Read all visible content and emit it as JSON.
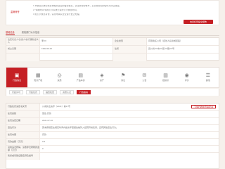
{
  "notice": {
    "label": "监管帐号",
    "lines": [
      "1.本信息系统仅供查询相关企业的备案信息，请注意保管帐号，妥善保管您的密码以防止泄露。",
      "2.\"填报时间\"指在公示系统上提交公示信息时间。",
      "3.如公示信息有误，请及时联系企业进行更正处理。"
    ],
    "report_button": "向商标局提交报告"
  },
  "tabs": [
    {
      "label": "基础信息",
      "active": true
    },
    {
      "label": "其他部门公示信息",
      "active": false
    }
  ],
  "info_rows": [
    [
      [
        "法定代表人/负责人/执行事务合伙人",
        "李XX"
      ],
      [
        "企业类型",
        "有限责任公司（自然人投资或控股）"
      ]
    ],
    [
      [
        "成立日期",
        "1992.09.20"
      ],
      [
        "住所",
        "四川省XX市XX区XX路XX号"
      ]
    ]
  ],
  "categories": [
    {
      "icon": "▣",
      "label": "行政信息",
      "active": true
    },
    {
      "icon": "▦",
      "label": "知识产权",
      "active": false
    },
    {
      "icon": "◎",
      "label": "资质",
      "active": false
    },
    {
      "icon": "▤",
      "label": "产品本身",
      "active": false
    },
    {
      "icon": "◈",
      "label": "资产",
      "active": false
    },
    {
      "icon": "⚑",
      "label": "诉讼",
      "active": false
    },
    {
      "icon": "✉",
      "label": "公告",
      "active": false
    },
    {
      "icon": "▥",
      "label": "招投标",
      "active": false
    },
    {
      "icon": "◉",
      "label": "评价",
      "active": false
    },
    {
      "icon": "☰",
      "label": "其他",
      "active": false
    }
  ],
  "subtabs": [
    {
      "label": "行政许可",
      "active": false
    },
    {
      "label": "行政处罚",
      "active": false
    },
    {
      "label": "抽查检查",
      "active": false
    },
    {
      "label": "资质认证",
      "active": false
    },
    {
      "label": "行政备案",
      "active": true
    }
  ],
  "details": [
    {
      "k": "行政处罚决定书文号",
      "v": "川成执法决字〔2021〕第17号",
      "pill": "下载行政处罚决定书"
    },
    {
      "k": "处罚类别",
      "v": "警告,罚款",
      "pill": ""
    },
    {
      "k": "处罚决定日期",
      "v": "2021.07.26",
      "pill": ""
    },
    {
      "k": "违法行为",
      "v": "因未按规定在规定时间内提交年度报告被列入经营异常名录，且有其他违法行为。",
      "pill": ""
    },
    {
      "k": "处罚内容",
      "v": "罚款",
      "pill": ""
    },
    {
      "k": "罚款金额（万元）",
      "v": "0.5",
      "pill": ""
    },
    {
      "k": "没收违法所得、没收非法财物的金额（万元）",
      "v": "0",
      "pill": ""
    },
    {
      "k": "暂扣或吊销证照名称及编号",
      "v": "",
      "pill": ""
    }
  ]
}
